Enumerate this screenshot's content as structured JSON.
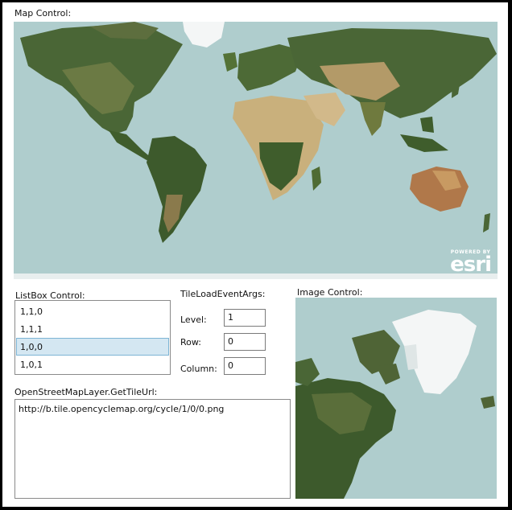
{
  "labels": {
    "map_control": "Map Control:",
    "listbox_control": "ListBox Control:",
    "tile_args": "TileLoadEventArgs:",
    "image_control": "Image Control:",
    "get_tile_url": "OpenStreetMapLayer.GetTileUrl:"
  },
  "esri": {
    "powered_by": "POWERED BY",
    "name": "esri"
  },
  "listbox": {
    "items": [
      "1,1,0",
      "1,1,1",
      "1,0,0",
      "1,0,1"
    ],
    "selected_index": 2
  },
  "tile_args": {
    "level_label": "Level:",
    "level_value": "1",
    "row_label": "Row:",
    "row_value": "0",
    "column_label": "Column:",
    "column_value": "0"
  },
  "tile_url": "http://b.tile.opencyclemap.org/cycle/1/0/0.png",
  "colors": {
    "ocean": "#afcdcd",
    "selection": "#d4e7f2",
    "land_green": "#3d5a2c",
    "land_desert": "#c9b07c",
    "ice": "#f4f6f6"
  }
}
